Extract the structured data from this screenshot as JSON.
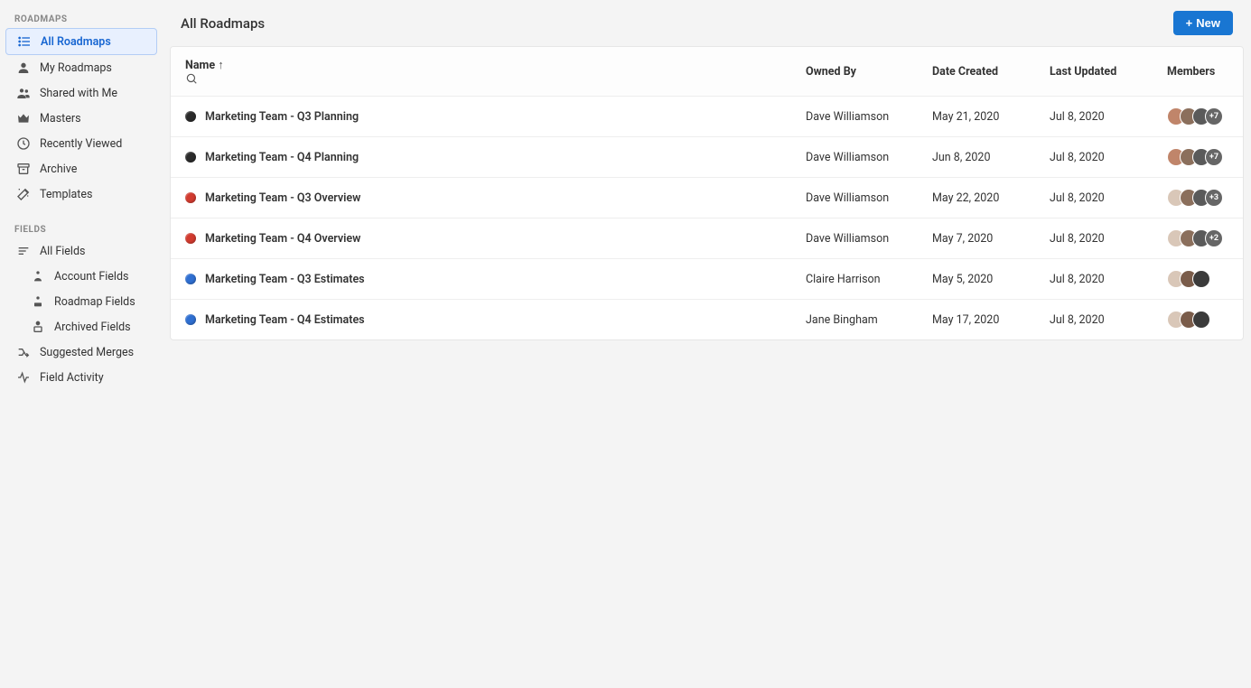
{
  "sidebar": {
    "sections": [
      {
        "title": "ROADMAPS",
        "items": [
          {
            "label": "All Roadmaps",
            "icon": "list"
          },
          {
            "label": "My Roadmaps",
            "icon": "person"
          },
          {
            "label": "Shared with Me",
            "icon": "people"
          },
          {
            "label": "Masters",
            "icon": "crown"
          },
          {
            "label": "Recently Viewed",
            "icon": "clock"
          },
          {
            "label": "Archive",
            "icon": "archive"
          },
          {
            "label": "Templates",
            "icon": "wand"
          }
        ]
      },
      {
        "title": "FIELDS",
        "items": [
          {
            "label": "All Fields",
            "icon": "lines"
          },
          {
            "label": "Account Fields",
            "icon": "node",
            "indent": true
          },
          {
            "label": "Roadmap Fields",
            "icon": "node",
            "indent": true
          },
          {
            "label": "Archived Fields",
            "icon": "node-archive",
            "indent": true
          },
          {
            "label": "Suggested Merges",
            "icon": "merge"
          },
          {
            "label": "Field Activity",
            "icon": "activity"
          }
        ]
      }
    ]
  },
  "header": {
    "title": "All Roadmaps",
    "new_button": "New"
  },
  "table": {
    "columns": {
      "name": "Name",
      "owner": "Owned By",
      "created": "Date Created",
      "updated": "Last Updated",
      "members": "Members"
    },
    "rows": [
      {
        "dot": "#2b2b2b",
        "name": "Marketing Team - Q3 Planning",
        "owner": "Dave Williamson",
        "created": "May 21, 2020",
        "updated": "Jul 8, 2020",
        "avatars": [
          "#c0856a",
          "#8b6f5c",
          "#5a5a5a"
        ],
        "more": "+7"
      },
      {
        "dot": "#2b2b2b",
        "name": "Marketing Team - Q4 Planning",
        "owner": "Dave Williamson",
        "created": "Jun 8, 2020",
        "updated": "Jul 8, 2020",
        "avatars": [
          "#c0856a",
          "#8b6f5c",
          "#5a5a5a"
        ],
        "more": "+7"
      },
      {
        "dot": "#d13b2f",
        "name": "Marketing Team - Q3 Overview",
        "owner": "Dave Williamson",
        "created": "May 22, 2020",
        "updated": "Jul 8, 2020",
        "avatars": [
          "#d9c7b8",
          "#8b6f5c",
          "#5a5a5a"
        ],
        "more": "+3"
      },
      {
        "dot": "#d13b2f",
        "name": "Marketing Team - Q4 Overview",
        "owner": "Dave Williamson",
        "created": "May 7, 2020",
        "updated": "Jul 8, 2020",
        "avatars": [
          "#d9c7b8",
          "#8b6f5c",
          "#5a5a5a"
        ],
        "more": "+2"
      },
      {
        "dot": "#2f6fd1",
        "name": "Marketing Team - Q3 Estimates",
        "owner": "Claire Harrison",
        "created": "May 5, 2020",
        "updated": "Jul 8, 2020",
        "avatars": [
          "#d9c7b8",
          "#7a5c4a",
          "#3b3b3b"
        ],
        "more": null
      },
      {
        "dot": "#2f6fd1",
        "name": "Marketing Team - Q4 Estimates",
        "owner": "Jane Bingham",
        "created": "May 17, 2020",
        "updated": "Jul 8, 2020",
        "avatars": [
          "#d9c7b8",
          "#7a5c4a",
          "#3b3b3b"
        ],
        "more": null
      }
    ]
  }
}
